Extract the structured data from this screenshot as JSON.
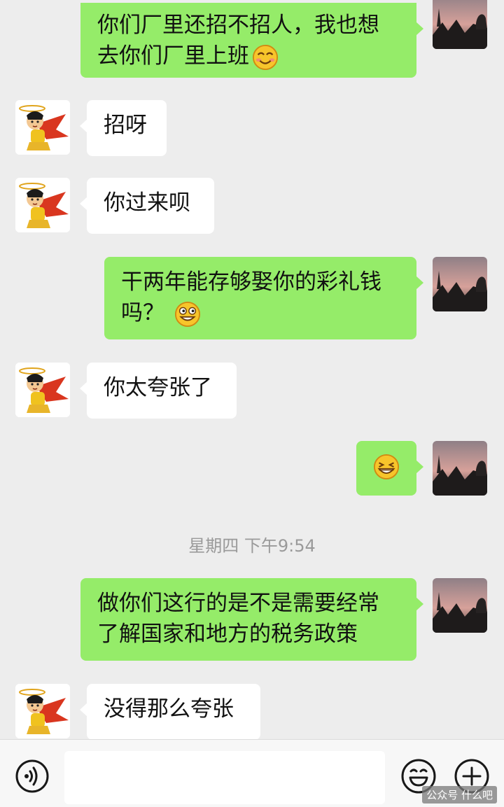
{
  "messages": [
    {
      "text_line1": "你们厂里还招不招人，我也想",
      "text_line2": "去你们厂里上班",
      "emoji": "smiling-blush-emoji"
    },
    {
      "text": "招呀"
    },
    {
      "text": "你过来呗"
    },
    {
      "text_line1": "干两年能存够娶你的彩礼钱",
      "text_line2": "吗？",
      "emoji": "grinning-wink-emoji"
    },
    {
      "text": "你太夸张了"
    },
    {
      "emoji": "grinning-squint-emoji"
    },
    {
      "text_line1": "做你们这行的是不是需要经常",
      "text_line2": "了解国家和地方的税务政策"
    },
    {
      "text": "没得那么夸张"
    }
  ],
  "timestamp": "星期四 下午9:54",
  "input_bar": {
    "value": ""
  },
  "watermark": "公众号 什么吧",
  "colors": {
    "outgoing": "#95ec69",
    "incoming": "#ffffff",
    "background": "#ededed"
  }
}
